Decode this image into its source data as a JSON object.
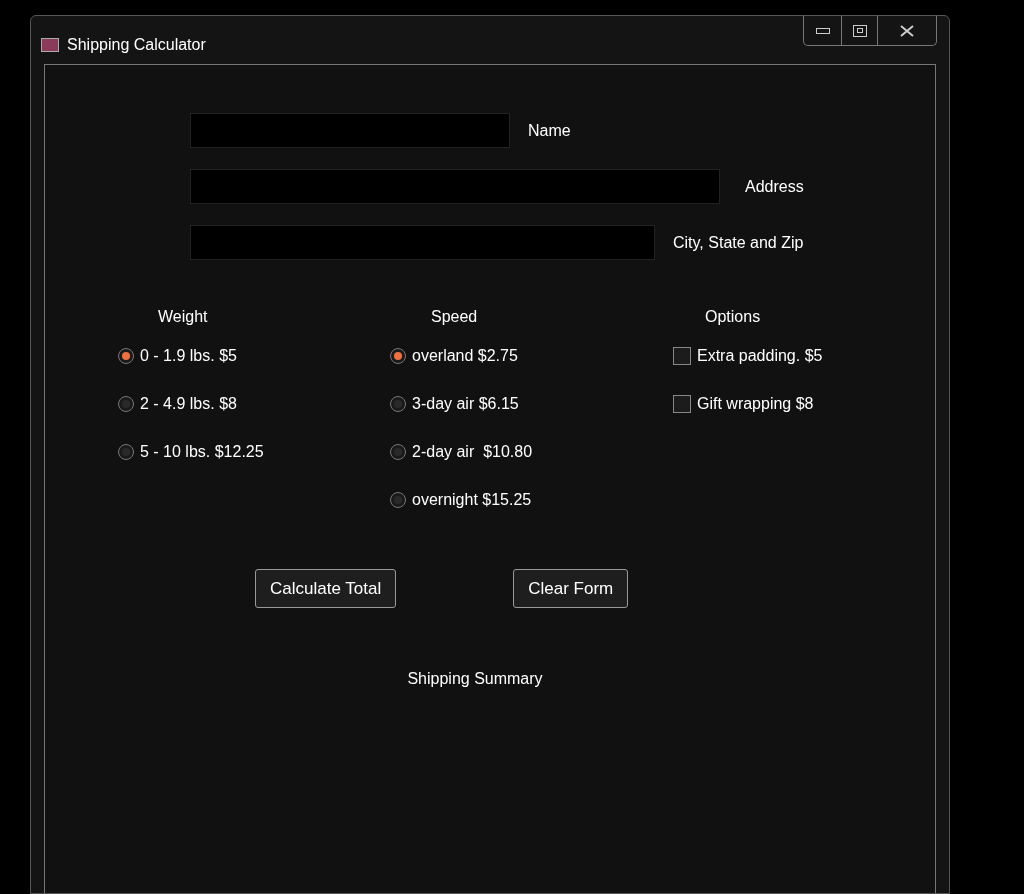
{
  "window": {
    "title": "Shipping Calculator"
  },
  "fields": [
    {
      "label": "Name"
    },
    {
      "label": "Address"
    },
    {
      "label": "City, State and Zip"
    }
  ],
  "groups": [
    {
      "heading": "Weight",
      "kind": "radio",
      "items": [
        {
          "label": "0 - 1.9 lbs. $5",
          "selected": true
        },
        {
          "label": "2 - 4.9 lbs. $8",
          "selected": false
        },
        {
          "label": "5 - 10 lbs. $12.25",
          "selected": false
        }
      ]
    },
    {
      "heading": "Speed",
      "kind": "radio",
      "items": [
        {
          "label": "overland $2.75",
          "selected": true
        },
        {
          "label": "3-day air $6.15",
          "selected": false
        },
        {
          "label": "2-day air  $10.80",
          "selected": false
        },
        {
          "label": "overnight $15.25",
          "selected": false
        }
      ]
    },
    {
      "heading": "Options",
      "kind": "checkbox",
      "items": [
        {
          "label": "Extra padding. $5",
          "checked": false
        },
        {
          "label": "Gift wrapping $8",
          "checked": false
        }
      ]
    }
  ],
  "buttons": [
    "Calculate Total",
    "Clear Form"
  ],
  "summary": "Shipping Summary"
}
